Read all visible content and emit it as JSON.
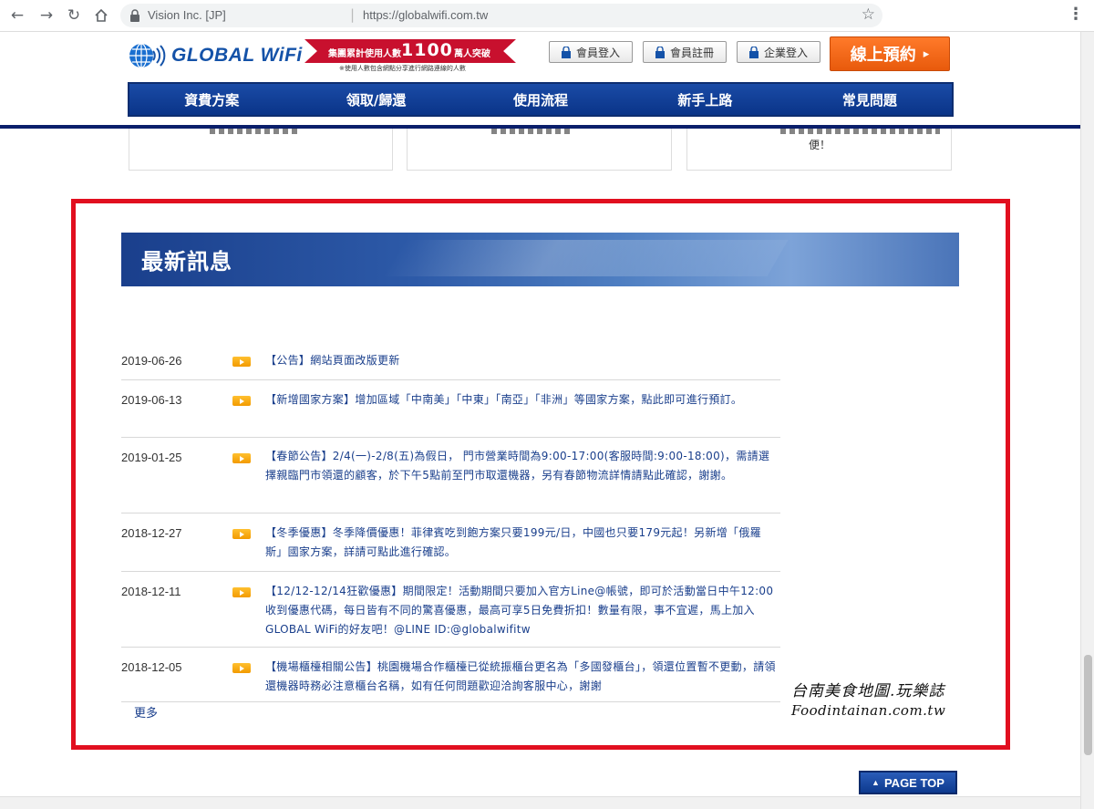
{
  "browser": {
    "site_name": "Vision Inc. [JP]",
    "separator": "|",
    "url": "https://globalwifi.com.tw"
  },
  "header": {
    "logo_text": "GLOBAL WiFi",
    "ribbon_text": "集團累計使用人數",
    "ribbon_number": "1100",
    "ribbon_unit": "萬人突破",
    "ribbon_note": "※使用人數包含網點分享進行網路連線的人數",
    "member_login": "會員登入",
    "member_register": "會員註冊",
    "corporate_login": "企業登入",
    "book_online": "線上預約",
    "book_arrow": "▸"
  },
  "nav": {
    "items": [
      "資費方案",
      "領取/歸還",
      "使用流程",
      "新手上路",
      "常見問題"
    ]
  },
  "cards": {
    "tail_text": "便！"
  },
  "banner": {
    "title": "最新訊息"
  },
  "news": [
    {
      "date": "2019-06-26",
      "text": "【公告】網站頁面改版更新"
    },
    {
      "date": "2019-06-13",
      "text": "【新增國家方案】增加區域「中南美」「中東」「南亞」「非洲」等國家方案，點此即可進行預訂。"
    },
    {
      "date": "2019-01-25",
      "text": "【春節公告】2/4(一)-2/8(五)為假日， 門市營業時間為9:00-17:00(客服時間:9:00-18:00)，需請選擇親臨門市領還的顧客，於下午5點前至門市取還機器，另有春節物流詳情請點此確認，謝謝。"
    },
    {
      "date": "2018-12-27",
      "text": "【冬季優惠】冬季降價優惠！菲律賓吃到飽方案只要199元/日，中國也只要179元起！另新增「俄羅斯」國家方案，詳請可點此進行確認。"
    },
    {
      "date": "2018-12-11",
      "text": "【12/12-12/14狂歡優惠】期間限定！活動期間只要加入官方Line@帳號，即可於活動當日中午12:00收到優惠代碼，每日皆有不同的驚喜優惠，最高可享5日免費折扣！數量有限，事不宜遲，馬上加入GLOBAL WiFi的好友吧！@LINE ID:@globalwifitw"
    },
    {
      "date": "2018-12-05",
      "text": "【機場櫃檯相關公告】桃園機場合作櫃檯已從統振櫃台更名為「多國發櫃台」，領還位置暫不更動，請領還機器時務必注意櫃台名稱，如有任何問題歡迎洽詢客服中心，謝謝"
    }
  ],
  "more_label": "更多",
  "watermark": {
    "line1": "台南美食地圖.玩樂誌",
    "line2": "Foodintainan.com.tw"
  },
  "page_top": {
    "arrow": "▲",
    "label": "PAGE TOP"
  },
  "colors": {
    "brand_blue": "#1452a8",
    "nav_blue": "#0a3488",
    "highlight_red": "#e10f1f",
    "book_orange": "#e85a0c"
  }
}
